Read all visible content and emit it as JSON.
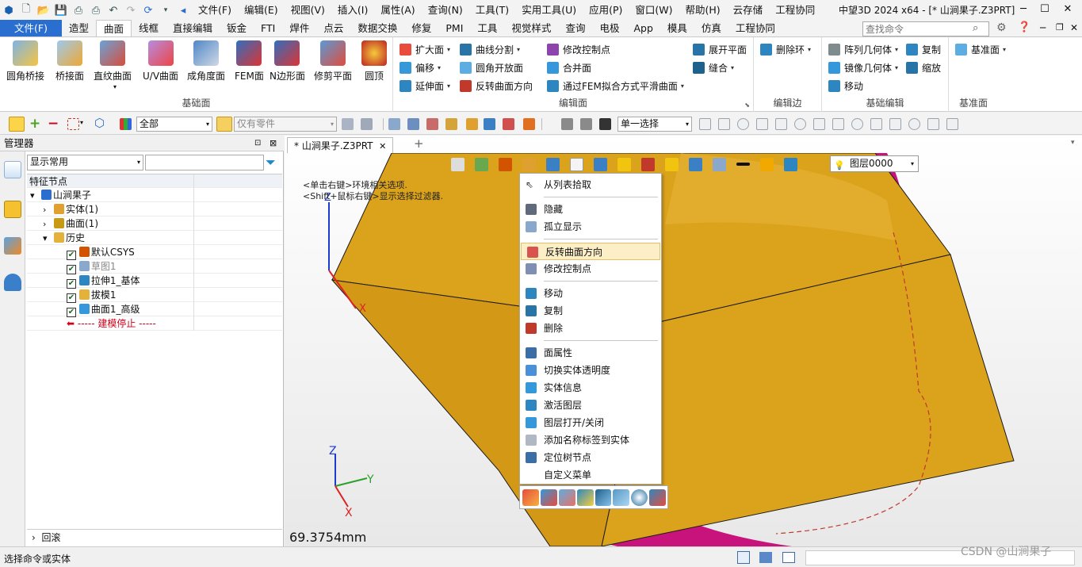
{
  "title_bar": {
    "menus": [
      "文件(F)",
      "编辑(E)",
      "视图(V)",
      "插入(I)",
      "属性(A)",
      "查询(N)",
      "工具(T)",
      "实用工具(U)",
      "应用(P)",
      "窗口(W)",
      "帮助(H)",
      "云存储",
      "工程协同"
    ],
    "window_title": "中望3D 2024 x64 - [* 山涧果子.Z3PRT]"
  },
  "ribbon_tabs": [
    "文件(F)",
    "造型",
    "曲面",
    "线框",
    "直接编辑",
    "钣金",
    "FTI",
    "焊件",
    "点云",
    "数据交换",
    "修复",
    "PMI",
    "工具",
    "视觉样式",
    "查询",
    "电极",
    "App",
    "模具",
    "仿真",
    "工程协同"
  ],
  "active_tab": "曲面",
  "search_placeholder": "查找命令",
  "ribbon": {
    "base_surface": {
      "label": "基础面",
      "buttons": [
        "圆角桥接",
        "桥接面",
        "直纹曲面",
        "U/V曲面",
        "成角度面",
        "FEM面",
        "N边形面",
        "修剪平面",
        "圆顶"
      ]
    },
    "edit_surface": {
      "label": "编辑面",
      "col1": [
        "扩大面",
        "偏移",
        "延伸面"
      ],
      "col2": [
        "曲线分割",
        "圆角开放面",
        "反转曲面方向"
      ],
      "col3": [
        "修改控制点",
        "合并面",
        "通过FEM拟合方式平滑曲面"
      ],
      "col4": [
        "展开平面",
        "缝合"
      ]
    },
    "edit_edge": {
      "label": "编辑边",
      "buttons": [
        "删除环"
      ]
    },
    "basic_edit": {
      "label": "基础编辑",
      "col1": [
        "阵列几何体",
        "镜像几何体",
        "移动"
      ],
      "col2": [
        "复制",
        "缩放"
      ]
    },
    "datum": {
      "label": "基准面",
      "buttons": [
        "基准面"
      ]
    }
  },
  "toolbar": {
    "filter_value": "全部",
    "part_filter": "仅有零件",
    "select_mode": "单一选择"
  },
  "manager": {
    "title": "管理器",
    "display_combo": "显示常用",
    "column_header": "特征节点",
    "tree": [
      {
        "label": "山涧果子",
        "indent": 0,
        "expander": "▾",
        "checked": null
      },
      {
        "label": "实体(1)",
        "indent": 1,
        "expander": "›",
        "checked": null
      },
      {
        "label": "曲面(1)",
        "indent": 1,
        "expander": "›",
        "checked": null
      },
      {
        "label": "历史",
        "indent": 1,
        "expander": "▾",
        "checked": null
      },
      {
        "label": "默认CSYS",
        "indent": 2,
        "expander": "",
        "checked": true
      },
      {
        "label": "草图1",
        "indent": 2,
        "expander": "",
        "checked": true
      },
      {
        "label": "拉伸1_基体",
        "indent": 2,
        "expander": "",
        "checked": true
      },
      {
        "label": "拔模1",
        "indent": 2,
        "expander": "",
        "checked": true
      },
      {
        "label": "曲面1_高级",
        "indent": 2,
        "expander": "",
        "checked": true
      },
      {
        "label": "----- 建模停止 -----",
        "indent": 2,
        "expander": "",
        "checked": null
      }
    ],
    "rollback": "回滚"
  },
  "viewport": {
    "doc_tab": "* 山涧果子.Z3PRT",
    "hint1": "<单击右键>环境相关选项.",
    "hint2": "<Shift+鼠标右键>显示选择过滤器.",
    "layer": "图层0000",
    "measure": "69.3754mm",
    "axes": {
      "x": "X",
      "y": "Y",
      "z": "Z"
    }
  },
  "context_menu": {
    "groups": [
      [
        "从列表拾取"
      ],
      [
        "隐藏",
        "孤立显示"
      ],
      [
        "反转曲面方向",
        "修改控制点"
      ],
      [
        "移动",
        "复制",
        "删除"
      ],
      [
        "面属性",
        "切换实体透明度",
        "实体信息",
        "激活图层",
        "图层打开/关闭",
        "添加名称标签到实体",
        "定位树节点",
        "自定义菜单"
      ]
    ],
    "highlighted": "反转曲面方向"
  },
  "status": {
    "text": "选择命令或实体"
  },
  "watermark": "CSDN @山涧果子",
  "colors": {
    "file_tab": "#2a6fcf",
    "solid": "#dba21b",
    "surface": "#c8127c",
    "highlight": "#fcefc8"
  }
}
